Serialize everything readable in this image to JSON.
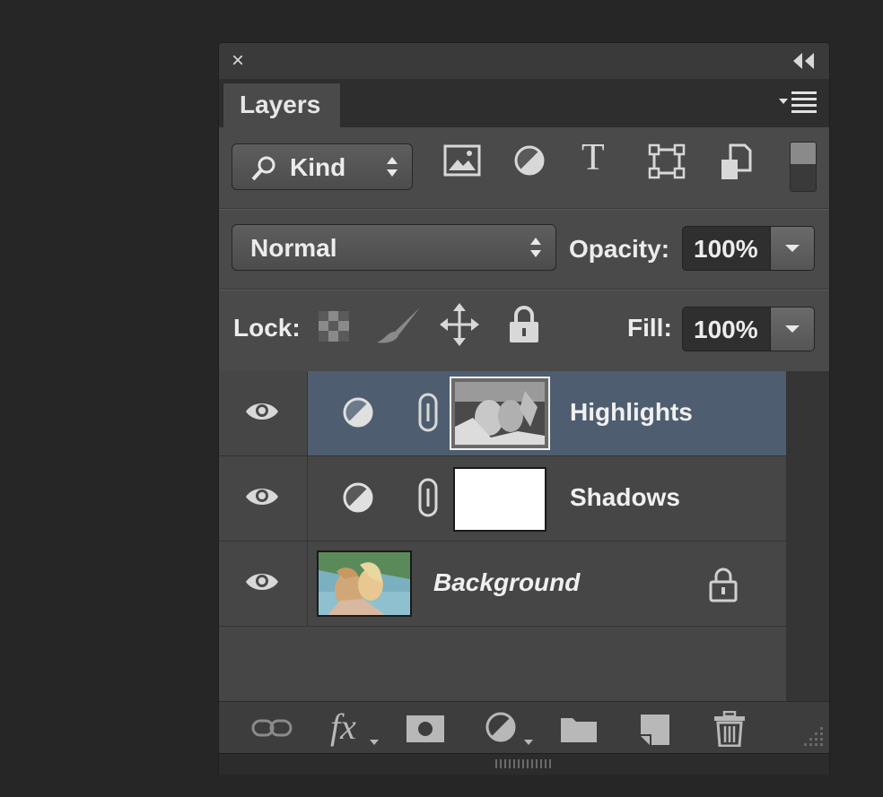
{
  "window": {
    "close_glyph": "×"
  },
  "tabs": [
    {
      "label": "Layers"
    }
  ],
  "filter": {
    "kind_label": "Kind",
    "icons": [
      "image-filter-icon",
      "adjustment-filter-icon",
      "type-filter-icon",
      "shape-filter-icon",
      "smart-object-filter-icon"
    ],
    "type_glyph": "T"
  },
  "blend": {
    "mode": "Normal",
    "opacity_label": "Opacity:",
    "opacity_value": "100%"
  },
  "lock": {
    "label": "Lock:",
    "fill_label": "Fill:",
    "fill_value": "100%"
  },
  "layers": [
    {
      "name": "Highlights",
      "type": "adjustment",
      "selected": true
    },
    {
      "name": "Shadows",
      "type": "adjustment",
      "selected": false
    },
    {
      "name": "Background",
      "type": "image",
      "locked": true,
      "selected": false
    }
  ],
  "bottom_bar": {
    "fx_label": "fx"
  },
  "colors": {
    "panel": "#4a4a4a",
    "selected_row": "#4e5e70",
    "background": "#262626"
  }
}
